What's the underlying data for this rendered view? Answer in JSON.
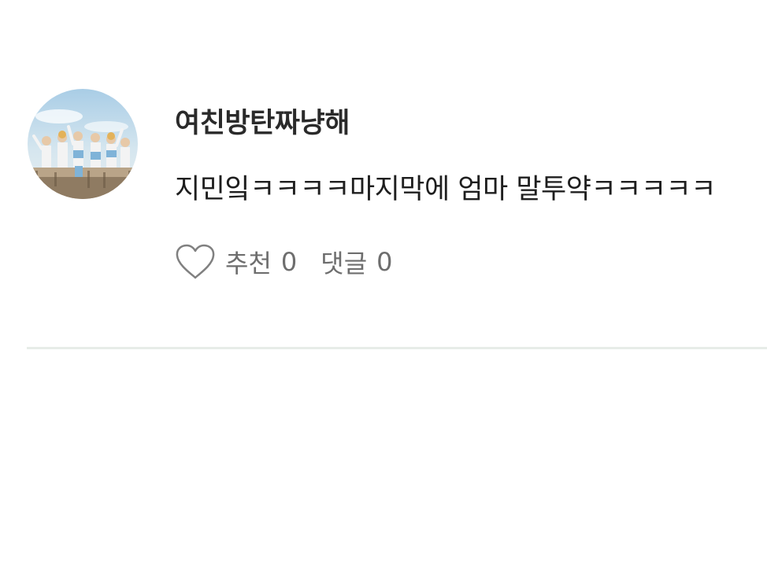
{
  "comment": {
    "username": "여친방탄짜냥해",
    "text": "지민잌ㅋㅋㅋㅋ마지막에 엄마 말투약ㅋㅋㅋㅋㅋ",
    "like_label": "추천",
    "like_count": "0",
    "reply_label": "댓글",
    "reply_count": "0"
  },
  "icons": {
    "avatar": "avatar-photo",
    "like": "heart-outline-icon"
  },
  "colors": {
    "username": "#2a2a2a",
    "text": "#1e1e1e",
    "meta": "#6e6e6e",
    "divider": "#e7ece8"
  }
}
